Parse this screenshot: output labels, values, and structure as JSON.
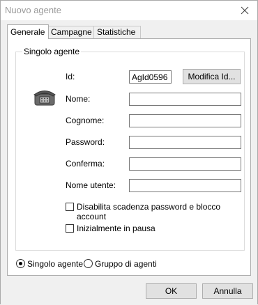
{
  "window": {
    "title": "Nuovo agente"
  },
  "tabs": [
    {
      "label": "Generale",
      "active": true
    },
    {
      "label": "Campagne",
      "active": false
    },
    {
      "label": "Statistiche",
      "active": false
    }
  ],
  "group": {
    "label": "Singolo agente"
  },
  "fields": {
    "id": {
      "label": "Id:",
      "value": "AgId0596"
    },
    "modify_id_label": "Modifica Id...",
    "nome": {
      "label": "Nome:",
      "value": ""
    },
    "cognome": {
      "label": "Cognome:",
      "value": ""
    },
    "password": {
      "label": "Password:",
      "value": ""
    },
    "conferma": {
      "label": "Conferma:",
      "value": ""
    },
    "nome_utente": {
      "label": "Nome utente:",
      "value": ""
    }
  },
  "checkboxes": {
    "disable_expiry": {
      "label": "Disabilita scadenza password e blocco account",
      "checked": false
    },
    "start_paused": {
      "label": "Inizialmente in pausa",
      "checked": false
    }
  },
  "radios": {
    "single": {
      "label": "Singolo agente",
      "selected": true
    },
    "group": {
      "label": "Gruppo di agenti",
      "selected": false
    }
  },
  "buttons": {
    "ok": "OK",
    "cancel": "Annulla"
  },
  "icons": {
    "close": "close-icon",
    "agent": "telephone-icon"
  }
}
